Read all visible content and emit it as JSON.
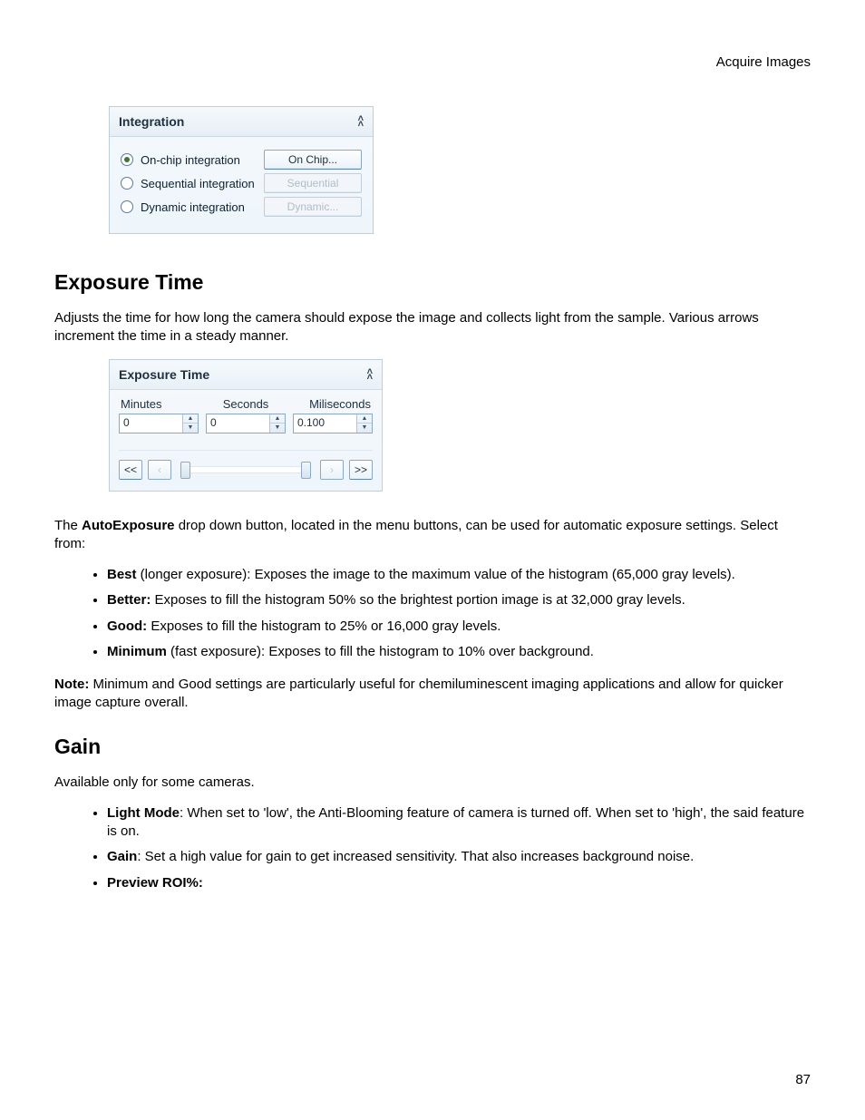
{
  "header": {
    "breadcrumb": "Acquire Images"
  },
  "integration_panel": {
    "title": "Integration",
    "options": [
      {
        "label": "On-chip integration",
        "selected": true,
        "button": "On Chip...",
        "enabled": true
      },
      {
        "label": "Sequential integration",
        "selected": false,
        "button": "Sequential",
        "enabled": false
      },
      {
        "label": "Dynamic integration",
        "selected": false,
        "button": "Dynamic...",
        "enabled": false
      }
    ]
  },
  "exposure_section": {
    "heading": "Exposure Time",
    "paragraph": "Adjusts the time for how long the camera should expose the image and collects light from the sample. Various arrows increment the time in a steady manner."
  },
  "exposure_panel": {
    "title": "Exposure Time",
    "cols": [
      {
        "label": "Minutes",
        "value": "0"
      },
      {
        "label": "Seconds",
        "value": "0"
      },
      {
        "label": "Miliseconds",
        "value": "0.100"
      }
    ],
    "buttons": {
      "first": "<<",
      "prev": "‹",
      "next": "›",
      "last": ">>"
    }
  },
  "autoexposure": {
    "intro_pre": "The ",
    "intro_bold": "AutoExposure",
    "intro_post": " drop down button, located in the menu buttons, can be used for automatic exposure settings. Select from:",
    "items": [
      {
        "bold": "Best",
        "text": " (longer exposure): Exposes the image to the maximum value of the histogram (65,000 gray levels)."
      },
      {
        "bold": "Better:",
        "text": " Exposes to fill the histogram 50% so the brightest portion image is at 32,000 gray levels."
      },
      {
        "bold": "Good:",
        "text": " Exposes to fill the histogram to 25% or 16,000 gray levels."
      },
      {
        "bold": "Minimum",
        "text": " (fast exposure): Exposes to fill the histogram to 10% over background."
      }
    ],
    "note_bold": "Note:",
    "note_text": " Minimum and Good settings are particularly useful for chemiluminescent imaging applications and allow for quicker image capture overall."
  },
  "gain_section": {
    "heading": "Gain",
    "intro": "Available only for some cameras.",
    "items": [
      {
        "bold": "Light Mode",
        "text": ": When set to 'low', the Anti-Blooming feature of camera is turned off. When set to 'high', the said feature is on."
      },
      {
        "bold": "Gain",
        "text": ": Set a high value for gain to get increased sensitivity. That also increases background noise."
      },
      {
        "bold": "Preview ROI%:",
        "text": ""
      }
    ]
  },
  "page_number": "87"
}
